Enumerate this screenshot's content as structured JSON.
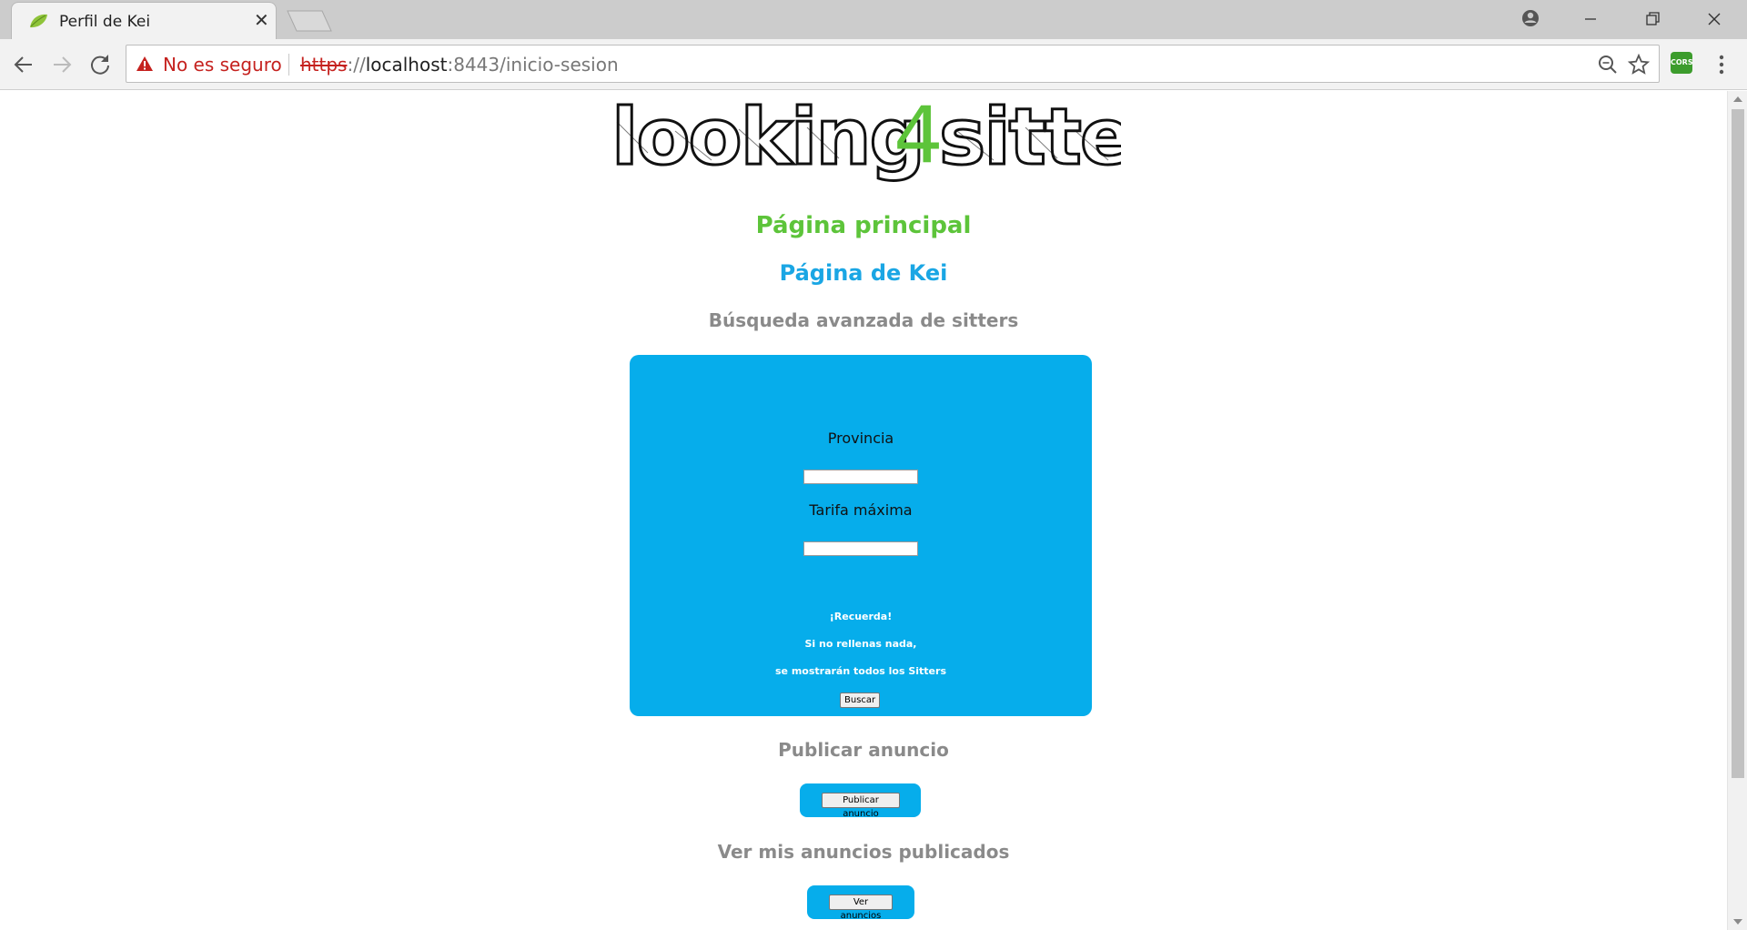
{
  "browser": {
    "tab_title": "Perfil de Kei",
    "security_label": "No es seguro",
    "url_scheme": "https",
    "url_sep": "://",
    "url_host": "localhost",
    "url_rest": ":8443/inicio-sesion",
    "extension_label": "CORS"
  },
  "page": {
    "logo_text_left": "looking",
    "logo_text_num": "4",
    "logo_text_right": "sitter",
    "main_link": "Página principal",
    "profile_link": "Página de Kei",
    "search_heading": "Búsqueda avanzada de sitters",
    "search_form": {
      "province_label": "Provincia",
      "province_value": "",
      "max_rate_label": "Tarifa máxima",
      "max_rate_value": "",
      "tip_line1": "¡Recuerda!",
      "tip_line2": "Si no rellenas nada,",
      "tip_line3": "se mostrarán todos los Sitters",
      "search_button": "Buscar"
    },
    "publish_heading": "Publicar anuncio",
    "publish_button": "Publicar anuncio",
    "my_ads_heading": "Ver mis anuncios publicados",
    "my_ads_button": "Ver anuncios"
  },
  "colors": {
    "accent_blue": "#06adeb",
    "green_link": "#5dc43a",
    "blue_link": "#1aa6e4",
    "heading_gray": "#8a8a8a",
    "warning_red": "#c5221f"
  }
}
